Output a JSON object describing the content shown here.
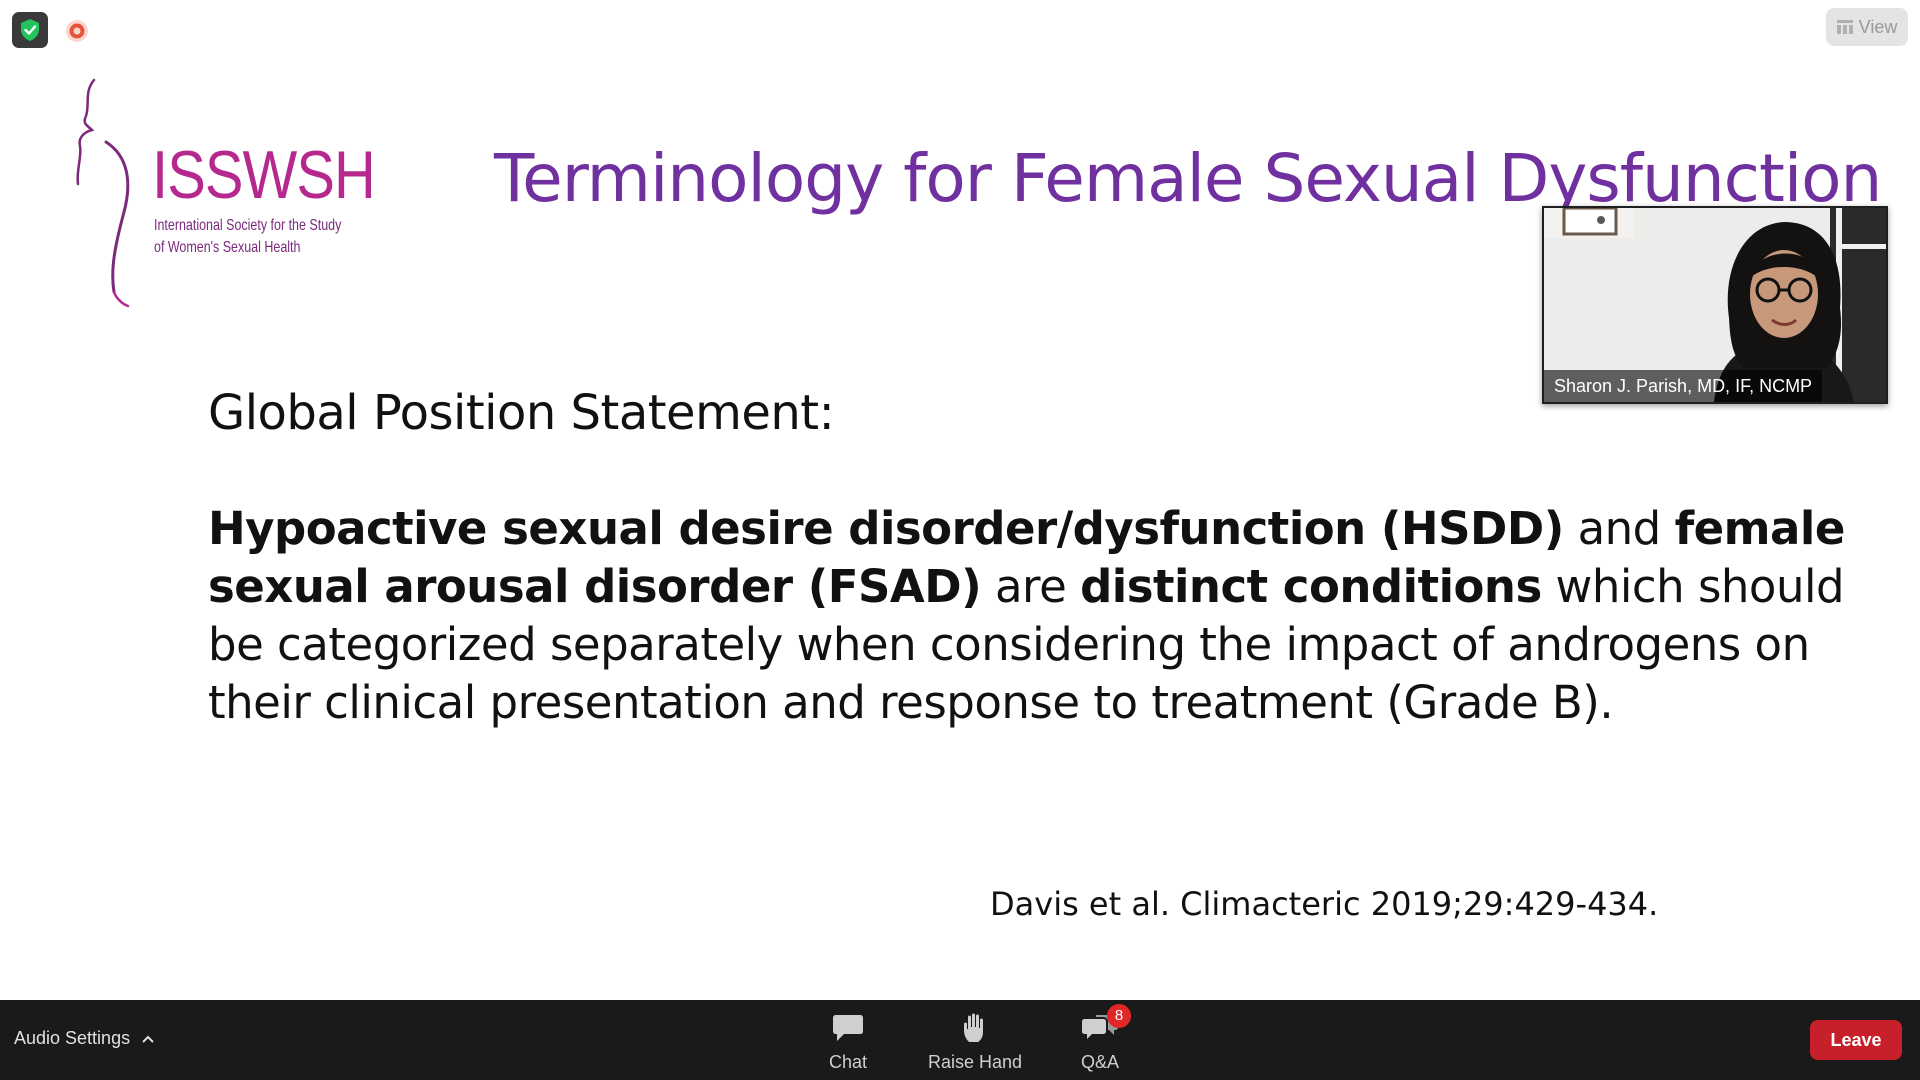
{
  "window": {
    "view_button_label": "View",
    "icons": [
      "shield-check-icon",
      "record-icon",
      "view-grid-icon"
    ]
  },
  "slide": {
    "logo": {
      "wordmark": "ISSWSH",
      "subtitle_line1": "International Society for the Study",
      "subtitle_line2": "of Women's Sexual Health",
      "color": "#b5298f"
    },
    "title": "Terminology for Female Sexual Dysfunction",
    "title_color": "#7030a0",
    "lead": "Global Position Statement:",
    "statement": {
      "b1": "Hypoactive sexual desire disorder/dysfunction (HSDD)",
      "t1": " and ",
      "b2": "female sexual arousal disorder (FSAD)",
      "t2": " are ",
      "b3": "distinct conditions",
      "t3": " which should be categorized separately when considering the impact of androgens on their clinical presentation and response to treatment (Grade B)."
    },
    "citation": "Davis et al. Climacteric 2019;29:429-434."
  },
  "speaker": {
    "name": "Sharon J. Parish, MD, IF, NCMP"
  },
  "toolbar": {
    "audio_settings_label": "Audio Settings",
    "chat_label": "Chat",
    "raise_hand_label": "Raise Hand",
    "qa_label": "Q&A",
    "qa_badge_count": "8",
    "leave_label": "Leave",
    "leave_color": "#c8202a"
  }
}
